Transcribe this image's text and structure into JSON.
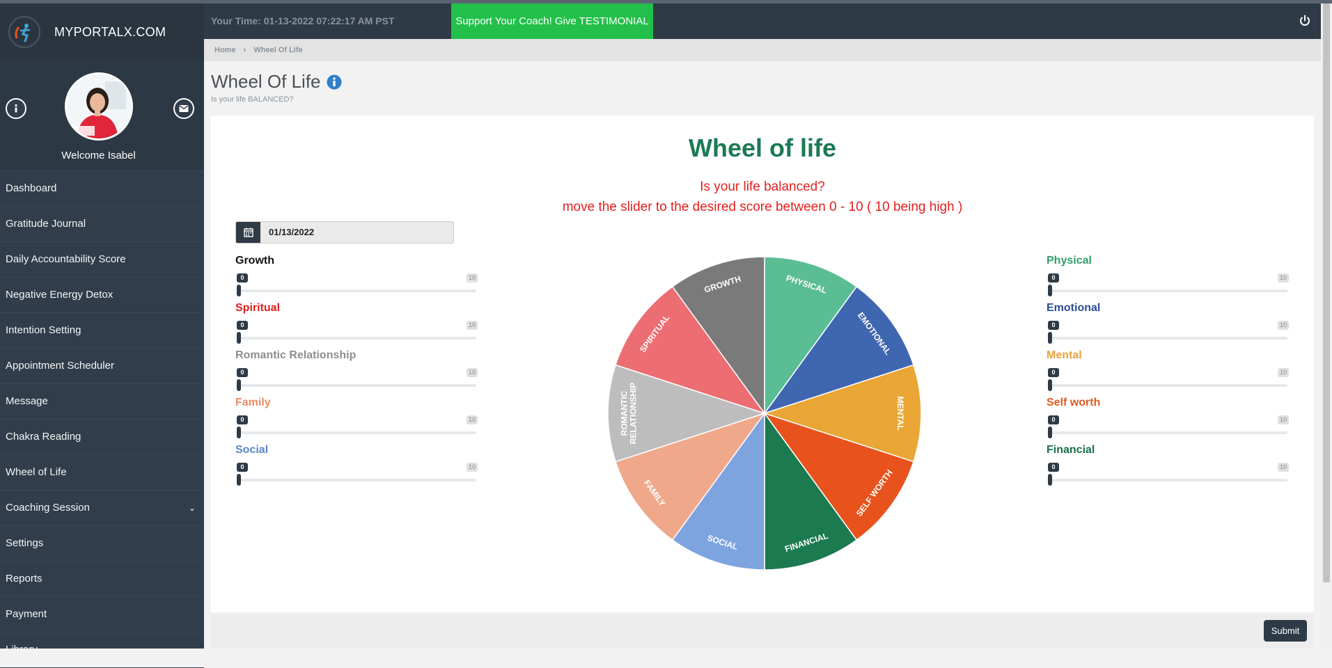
{
  "brand": {
    "name": "MYPORTALX.COM"
  },
  "profile": {
    "welcome": "Welcome Isabel"
  },
  "sidebar": {
    "items": [
      {
        "label": "Dashboard"
      },
      {
        "label": "Gratitude Journal"
      },
      {
        "label": "Daily Accountability Score"
      },
      {
        "label": "Negative Energy Detox"
      },
      {
        "label": "Intention Setting"
      },
      {
        "label": "Appointment Scheduler"
      },
      {
        "label": "Message"
      },
      {
        "label": "Chakra Reading"
      },
      {
        "label": "Wheel of Life"
      },
      {
        "label": "Coaching Session"
      },
      {
        "label": "Settings"
      },
      {
        "label": "Reports"
      },
      {
        "label": "Payment"
      },
      {
        "label": "Library"
      }
    ]
  },
  "header": {
    "time": "Your Time: 01-13-2022 07:22:17 AM PST",
    "support": "Support Your Coach! Give TESTIMONIAL"
  },
  "breadcrumb": {
    "home": "Home",
    "sep": "›",
    "current": "Wheel Of Life"
  },
  "page": {
    "title": "Wheel Of Life",
    "subtitle": "Is your life BALANCED?"
  },
  "card": {
    "title": "Wheel of life",
    "question": "Is your life balanced?",
    "instruction": "move the slider to the desired score between 0 - 10 ( 10 being high )",
    "date": "01/13/2022"
  },
  "sliders": {
    "left": [
      {
        "label": "Growth",
        "color": "#111111",
        "value": 0,
        "min_label": "0",
        "max_label": "10"
      },
      {
        "label": "Spiritual",
        "color": "#e41e1e",
        "value": 0,
        "min_label": "0",
        "max_label": "10"
      },
      {
        "label": "Romantic Relationship",
        "color": "#8e8e8e",
        "value": 0,
        "min_label": "0",
        "max_label": "10"
      },
      {
        "label": "Family",
        "color": "#ee8a64",
        "value": 0,
        "min_label": "0",
        "max_label": "10"
      },
      {
        "label": "Social",
        "color": "#5b86d1",
        "value": 0,
        "min_label": "0",
        "max_label": "10"
      }
    ],
    "right": [
      {
        "label": "Physical",
        "color": "#2f9e6a",
        "value": 0,
        "min_label": "0",
        "max_label": "10"
      },
      {
        "label": "Emotional",
        "color": "#2b4c94",
        "value": 0,
        "min_label": "0",
        "max_label": "10"
      },
      {
        "label": "Mental",
        "color": "#e8a13a",
        "value": 0,
        "min_label": "0",
        "max_label": "10"
      },
      {
        "label": "Self worth",
        "color": "#e05a1f",
        "value": 0,
        "min_label": "0",
        "max_label": "10"
      },
      {
        "label": "Financial",
        "color": "#1b6e48",
        "value": 0,
        "min_label": "0",
        "max_label": "10"
      }
    ]
  },
  "wheel": {
    "segments": [
      {
        "label": "PHYSICAL",
        "color": "#5bbd93"
      },
      {
        "label": "EMOTIONAL",
        "color": "#3f66b0"
      },
      {
        "label": "MENTAL",
        "color": "#eaa634"
      },
      {
        "label": "SELF WORTH",
        "color": "#e8531d"
      },
      {
        "label": "FINANCIAL",
        "color": "#1c7a50"
      },
      {
        "label": "SOCIAL",
        "color": "#7ea4e0"
      },
      {
        "label": "FAMILY",
        "color": "#efa98a"
      },
      {
        "label": "ROMANTIC RELATIONSHIP",
        "color": "#bdbdbd"
      },
      {
        "label": "SPIRITUAL",
        "color": "#ec6d72"
      },
      {
        "label": "GROWTH",
        "color": "#7a7a7a"
      }
    ]
  },
  "actions": {
    "submit": "Submit"
  }
}
